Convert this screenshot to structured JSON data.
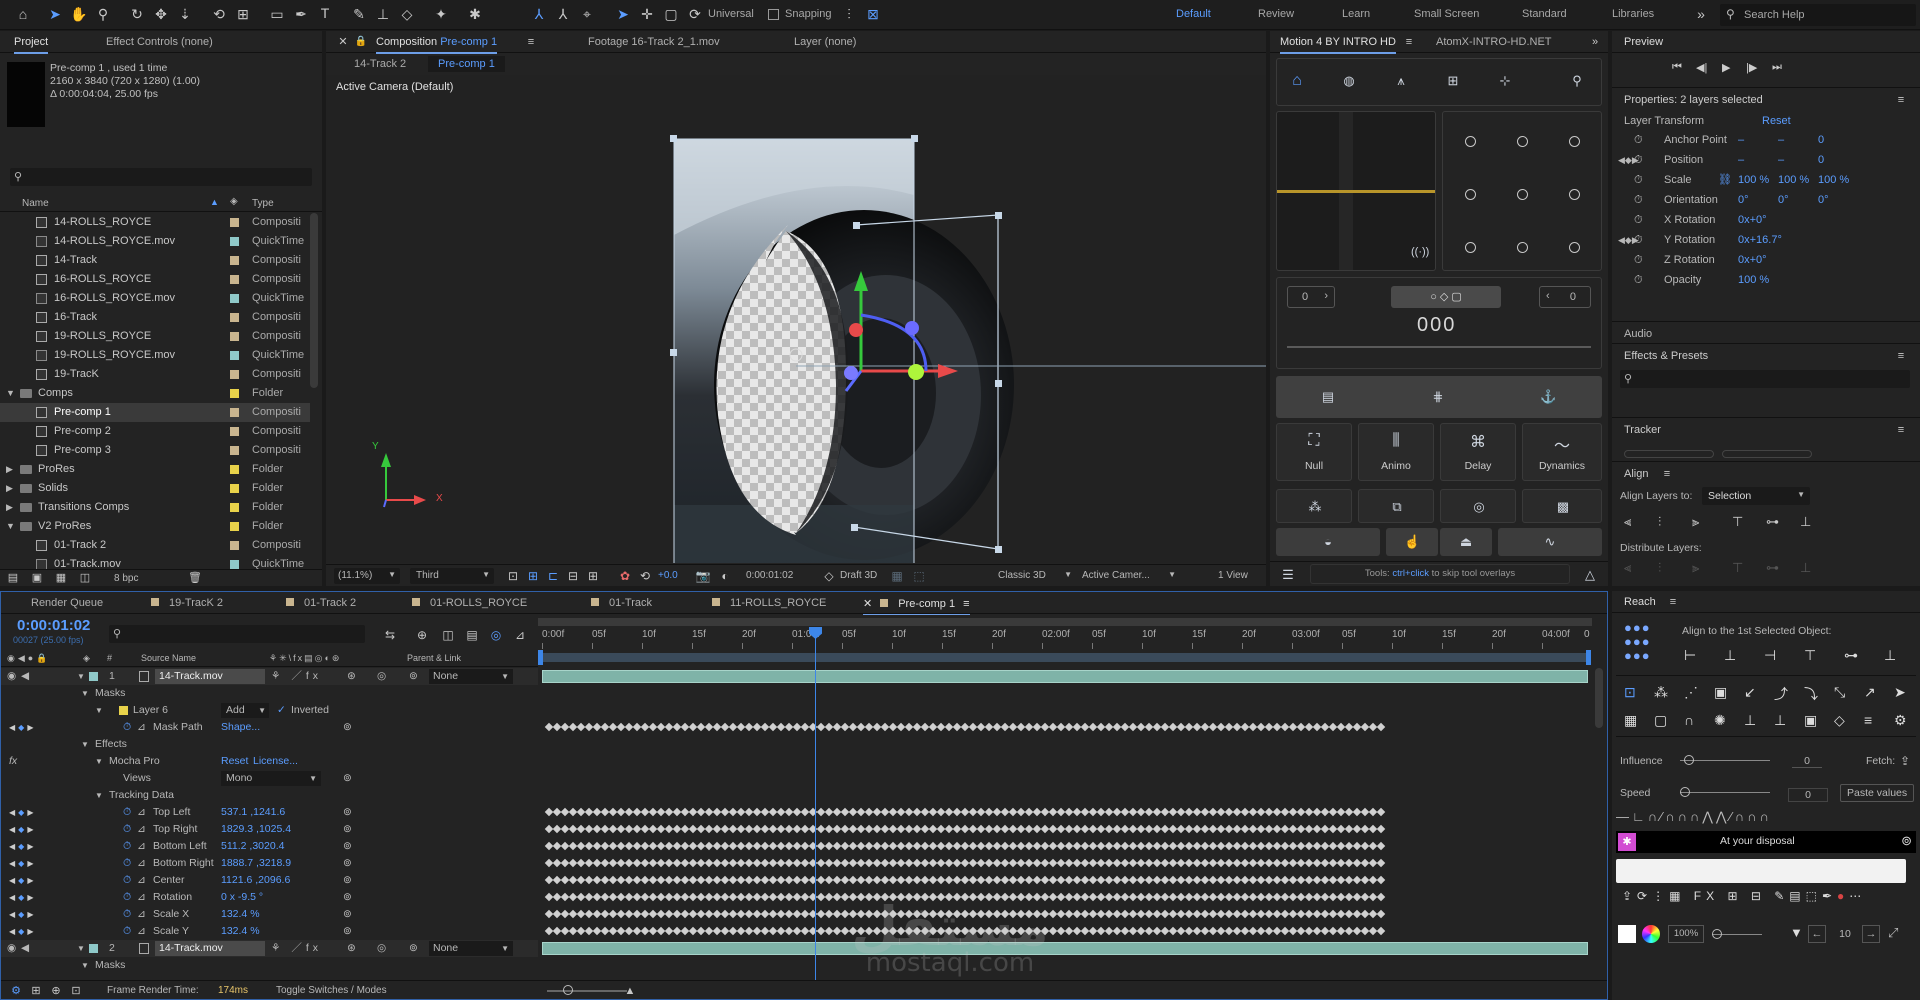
{
  "toolbar": {
    "universal": "Universal",
    "snapping": "Snapping",
    "workspaces": [
      "Default",
      "Review",
      "Learn",
      "Small Screen",
      "Standard",
      "Libraries"
    ],
    "search_help": "Search Help"
  },
  "project_panel": {
    "tab_project": "Project",
    "tab_effect_controls": "Effect Controls (none)",
    "selected_name": "Pre-comp 1",
    "used": ", used 1 time",
    "dims": "2160 x 3840  (720 x 1280) (1.00)",
    "duration": "Δ 0:00:04:04, 25.00 fps",
    "search_placeholder": "",
    "col_name": "Name",
    "col_type": "Type",
    "bpc": "8 bpc",
    "items": [
      {
        "name": "14-ROLLS_ROYCE",
        "type": "Compositi",
        "kind": "comp",
        "color": "#c9b58f",
        "indent": 1
      },
      {
        "name": "14-ROLLS_ROYCE.mov",
        "type": "QuickTime",
        "kind": "mov",
        "color": "#8fc9c9",
        "indent": 1
      },
      {
        "name": "14-Track",
        "type": "Compositi",
        "kind": "comp",
        "color": "#c9b58f",
        "indent": 1
      },
      {
        "name": "16-ROLLS_ROYCE",
        "type": "Compositi",
        "kind": "comp",
        "color": "#c9b58f",
        "indent": 1
      },
      {
        "name": "16-ROLLS_ROYCE.mov",
        "type": "QuickTime",
        "kind": "mov",
        "color": "#8fc9c9",
        "indent": 1
      },
      {
        "name": "16-Track",
        "type": "Compositi",
        "kind": "comp",
        "color": "#c9b58f",
        "indent": 1
      },
      {
        "name": "19-ROLLS_ROYCE",
        "type": "Compositi",
        "kind": "comp",
        "color": "#c9b58f",
        "indent": 1
      },
      {
        "name": "19-ROLLS_ROYCE.mov",
        "type": "QuickTime",
        "kind": "mov",
        "color": "#8fc9c9",
        "indent": 1
      },
      {
        "name": "19-TracK",
        "type": "Compositi",
        "kind": "comp",
        "color": "#c9b58f",
        "indent": 1
      },
      {
        "name": "Comps",
        "type": "Folder",
        "kind": "folder",
        "color": "#e8d24a",
        "indent": 0
      },
      {
        "name": "Pre-comp 1",
        "type": "Compositi",
        "kind": "comp",
        "color": "#c9b58f",
        "indent": 1,
        "selected": true
      },
      {
        "name": "Pre-comp 2",
        "type": "Compositi",
        "kind": "comp",
        "color": "#c9b58f",
        "indent": 1
      },
      {
        "name": "Pre-comp 3",
        "type": "Compositi",
        "kind": "comp",
        "color": "#c9b58f",
        "indent": 1
      },
      {
        "name": "ProRes",
        "type": "Folder",
        "kind": "folder",
        "color": "#e8d24a",
        "indent": 0
      },
      {
        "name": "Solids",
        "type": "Folder",
        "kind": "folder",
        "color": "#e8d24a",
        "indent": 0
      },
      {
        "name": "Transitions Comps",
        "type": "Folder",
        "kind": "folder",
        "color": "#e8d24a",
        "indent": 0
      },
      {
        "name": "V2 ProRes",
        "type": "Folder",
        "kind": "folder",
        "color": "#e8d24a",
        "indent": 0
      },
      {
        "name": "01-Track 2",
        "type": "Compositi",
        "kind": "comp",
        "color": "#c9b58f",
        "indent": 1
      },
      {
        "name": "01-Track.mov",
        "type": "QuickTime",
        "kind": "mov",
        "color": "#8fc9c9",
        "indent": 1
      }
    ]
  },
  "comp_panel": {
    "tab_comp_prefix": "Composition",
    "tab_comp_name": "Pre-comp 1",
    "tab_footage": "Footage  16-Track 2_1.mov",
    "tab_layer": "Layer  (none)",
    "crumb1": "14-Track 2",
    "crumb2": "Pre-comp 1",
    "camera": "Active Camera (Default)",
    "zoom": "(11.1%)",
    "resolution": "Third",
    "exposure": "+0.0",
    "timecode": "0:00:01:02",
    "draft3d": "Draft 3D",
    "renderer": "Classic 3D",
    "view_camera": "Active Camer...",
    "views": "1 View",
    "axis_x": "X",
    "axis_y": "Y"
  },
  "motion_panel": {
    "tab1": "Motion 4 BY INTRO HD",
    "tab2": "AtomX-INTRO-HD.NET",
    "num_left": "0",
    "num_right": "0",
    "big_num": "000",
    "tools": [
      {
        "label": "Null",
        "icon": "null-icon"
      },
      {
        "label": "Animo",
        "icon": "animo-icon"
      },
      {
        "label": "Delay",
        "icon": "delay-icon"
      },
      {
        "label": "Dynamics",
        "icon": "dynamics-icon"
      }
    ],
    "hint_prefix": "Tools: ",
    "hint_link": "ctrl+click",
    "hint_suffix": " to skip tool overlays"
  },
  "preview_panel": {
    "title": "Preview"
  },
  "properties_panel": {
    "title": "Properties: 2 layers selected",
    "section": "Layer Transform",
    "reset": "Reset",
    "props": [
      {
        "name": "Anchor Point",
        "v1": "–",
        "v2": "–",
        "v3": "0"
      },
      {
        "name": "Position",
        "v1": "–",
        "v2": "–",
        "v3": "0"
      },
      {
        "name": "Scale",
        "v1": "100 %",
        "v2": "100 %",
        "v3": "100 %"
      },
      {
        "name": "Orientation",
        "v1": "0°",
        "v2": "0°",
        "v3": "0°"
      },
      {
        "name": "X Rotation",
        "v1": "0x+0°",
        "v2": "",
        "v3": ""
      },
      {
        "name": "Y Rotation",
        "v1": "0x+16.7°",
        "v2": "",
        "v3": ""
      },
      {
        "name": "Z Rotation",
        "v1": "0x+0°",
        "v2": "",
        "v3": ""
      },
      {
        "name": "Opacity",
        "v1": "100 %",
        "v2": "",
        "v3": ""
      }
    ],
    "audio": "Audio",
    "effects_presets": "Effects & Presets",
    "tracker": "Tracker",
    "align": "Align",
    "align_layers_to": "Align Layers to:",
    "align_target": "Selection",
    "distribute": "Distribute Layers:"
  },
  "reach_panel": {
    "title": "Reach",
    "align_label": "Align to the 1st Selected Object:",
    "influence": "Influence",
    "influence_val": "0",
    "fetch": "Fetch:",
    "speed": "Speed",
    "speed_val": "0",
    "paste_values": "Paste values",
    "disposal": "At your disposal",
    "zoom": "100%",
    "num": "10"
  },
  "timeline": {
    "tabs": [
      "Render Queue",
      "19-TracK 2",
      "01-Track 2",
      "01-ROLLS_ROYCE",
      "01-Track",
      "11-ROLLS_ROYCE",
      "Pre-comp 1"
    ],
    "tab_colors": [
      "",
      "#c9b58f",
      "#c9b58f",
      "#c9b58f",
      "#c9b58f",
      "#c9b58f",
      "#c9b58f"
    ],
    "timecode": "0:00:01:02",
    "frames": "00027 (25.00 fps)",
    "col_source": "Source Name",
    "col_parent": "Parent & Link",
    "ruler": [
      "0:00f",
      "05f",
      "10f",
      "15f",
      "20f",
      "01:00f",
      "05f",
      "10f",
      "15f",
      "20f",
      "02:00f",
      "05f",
      "10f",
      "15f",
      "20f",
      "03:00f",
      "05f",
      "10f",
      "15f",
      "20f",
      "04:00f"
    ],
    "ruler_end": "0",
    "layers": [
      {
        "num": "1",
        "name": "14-Track.mov",
        "parent": "None"
      },
      {
        "num": "2",
        "name": "14-Track.mov",
        "parent": "None"
      }
    ],
    "rows": [
      {
        "label": "Masks",
        "indent": 1,
        "kind": "group"
      },
      {
        "label": "Layer 6",
        "indent": 2,
        "kind": "mask",
        "mode": "Add",
        "inverted": "Inverted"
      },
      {
        "label": "Mask Path",
        "indent": 3,
        "kind": "prop",
        "value": "Shape...",
        "kf": true
      },
      {
        "label": "Effects",
        "indent": 1,
        "kind": "group"
      },
      {
        "label": "Mocha Pro",
        "indent": 2,
        "kind": "effect",
        "reset": "Reset",
        "license": "License..."
      },
      {
        "label": "Views",
        "indent": 3,
        "kind": "select",
        "value": "Mono"
      },
      {
        "label": "Tracking Data",
        "indent": 2,
        "kind": "group"
      },
      {
        "label": "Top Left",
        "indent": 3,
        "kind": "prop",
        "value": "537.1 ,1241.6",
        "kf": true
      },
      {
        "label": "Top Right",
        "indent": 3,
        "kind": "prop",
        "value": "1829.3 ,1025.4",
        "kf": true
      },
      {
        "label": "Bottom Left",
        "indent": 3,
        "kind": "prop",
        "value": "511.2 ,3020.4",
        "kf": true
      },
      {
        "label": "Bottom Right",
        "indent": 3,
        "kind": "prop",
        "value": "1888.7 ,3218.9",
        "kf": true
      },
      {
        "label": "Center",
        "indent": 3,
        "kind": "prop",
        "value": "1121.6 ,2096.6",
        "kf": true
      },
      {
        "label": "Rotation",
        "indent": 3,
        "kind": "prop",
        "value": "0 x -9.5 °",
        "kf": true
      },
      {
        "label": "Scale X",
        "indent": 3,
        "kind": "prop",
        "value": "132.4 %",
        "kf": true
      },
      {
        "label": "Scale Y",
        "indent": 3,
        "kind": "prop",
        "value": "132.4 %",
        "kf": true
      }
    ],
    "masks2": "Masks",
    "frame_render_label": "Frame Render Time:",
    "frame_render_val": "174ms",
    "toggle": "Toggle Switches / Modes"
  },
  "watermark": {
    "arabic": "مستقل",
    "latin": "mostaql.com"
  }
}
